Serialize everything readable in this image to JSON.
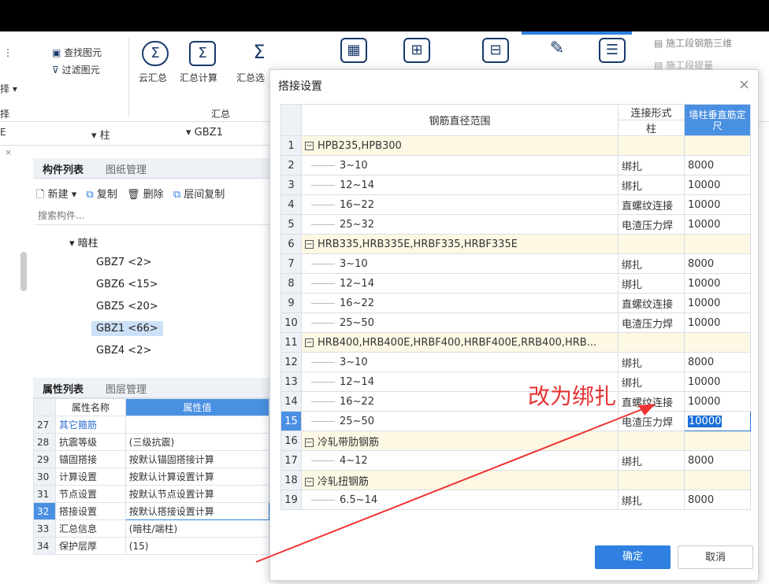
{
  "ribbon": {
    "find_element": "查找图元",
    "filter_element": "过滤图元",
    "select_label": "择",
    "group_select": "择",
    "cloud_sum": "云汇总",
    "sum_calc": "汇总计算",
    "sum_select": "汇总选",
    "group_sum": "汇总",
    "rebar_3d": "施工段钢筋三维",
    "extract": "施工段提量"
  },
  "filter": {
    "type": "柱",
    "name": "GBZ1"
  },
  "component_panel": {
    "tab_active": "构件列表",
    "tab_other": "图纸管理",
    "new": "新建",
    "copy": "复制",
    "delete": "删除",
    "floor_copy": "层间复制",
    "search_placeholder": "搜索构件...",
    "tree_root": "暗柱",
    "items": [
      "GBZ7 <2>",
      "GBZ6 <15>",
      "GBZ5 <20>",
      "GBZ1 <66>",
      "GBZ4 <2>"
    ]
  },
  "property_panel": {
    "tab_active": "属性列表",
    "tab_other": "图层管理",
    "col_name": "属性名称",
    "col_value": "属性值",
    "rows": [
      {
        "num": "27",
        "name": "其它箍筋",
        "value": ""
      },
      {
        "num": "28",
        "name": "抗震等级",
        "value": "(三级抗震)"
      },
      {
        "num": "29",
        "name": "锚固搭接",
        "value": "按默认锚固搭接计算"
      },
      {
        "num": "30",
        "name": "计算设置",
        "value": "按默认计算设置计算"
      },
      {
        "num": "31",
        "name": "节点设置",
        "value": "按默认节点设置计算"
      },
      {
        "num": "32",
        "name": "搭接设置",
        "value": "按默认搭接设置计算"
      },
      {
        "num": "33",
        "name": "汇总信息",
        "value": "(暗柱/端柱)"
      },
      {
        "num": "34",
        "name": "保护层厚",
        "value": "(15)"
      }
    ]
  },
  "dialog": {
    "title": "搭接设置",
    "close": "×",
    "col_range": "钢筋直径范围",
    "col_conn": "连接形式",
    "col_conn_sub": "柱",
    "col_len": "墙柱垂直筋定尺",
    "rows": [
      {
        "n": "1",
        "group": true,
        "range": "HPB235,HPB300",
        "conn": "",
        "len": ""
      },
      {
        "n": "2",
        "group": false,
        "range": "3~10",
        "conn": "绑扎",
        "len": "8000"
      },
      {
        "n": "3",
        "group": false,
        "range": "12~14",
        "conn": "绑扎",
        "len": "10000"
      },
      {
        "n": "4",
        "group": false,
        "range": "16~22",
        "conn": "直螺纹连接",
        "len": "10000"
      },
      {
        "n": "5",
        "group": false,
        "range": "25~32",
        "conn": "电渣压力焊",
        "len": "10000"
      },
      {
        "n": "6",
        "group": true,
        "range": "HRB335,HRB335E,HRBF335,HRBF335E",
        "conn": "",
        "len": ""
      },
      {
        "n": "7",
        "group": false,
        "range": "3~10",
        "conn": "绑扎",
        "len": "8000"
      },
      {
        "n": "8",
        "group": false,
        "range": "12~14",
        "conn": "绑扎",
        "len": "10000"
      },
      {
        "n": "9",
        "group": false,
        "range": "16~22",
        "conn": "直螺纹连接",
        "len": "10000"
      },
      {
        "n": "10",
        "group": false,
        "range": "25~50",
        "conn": "电渣压力焊",
        "len": "10000"
      },
      {
        "n": "11",
        "group": true,
        "range": "HRB400,HRB400E,HRBF400,HRBF400E,RRB400,HRB...",
        "conn": "",
        "len": ""
      },
      {
        "n": "12",
        "group": false,
        "range": "3~10",
        "conn": "绑扎",
        "len": "8000"
      },
      {
        "n": "13",
        "group": false,
        "range": "12~14",
        "conn": "绑扎",
        "len": "10000"
      },
      {
        "n": "14",
        "group": false,
        "range": "16~22",
        "conn": "直螺纹连接",
        "len": "10000"
      },
      {
        "n": "15",
        "group": false,
        "range": "25~50",
        "conn": "电渣压力焊",
        "len": "10000"
      },
      {
        "n": "16",
        "group": true,
        "range": "冷轧带肋钢筋",
        "conn": "",
        "len": ""
      },
      {
        "n": "17",
        "group": false,
        "range": "4~12",
        "conn": "绑扎",
        "len": "8000"
      },
      {
        "n": "18",
        "group": true,
        "range": "冷轧扭钢筋",
        "conn": "",
        "len": ""
      },
      {
        "n": "19",
        "group": false,
        "range": "6.5~14",
        "conn": "绑扎",
        "len": "8000"
      }
    ],
    "ok": "确定",
    "cancel": "取消"
  },
  "annotation": {
    "text": "改为绑扎",
    "color": "#e53333"
  }
}
